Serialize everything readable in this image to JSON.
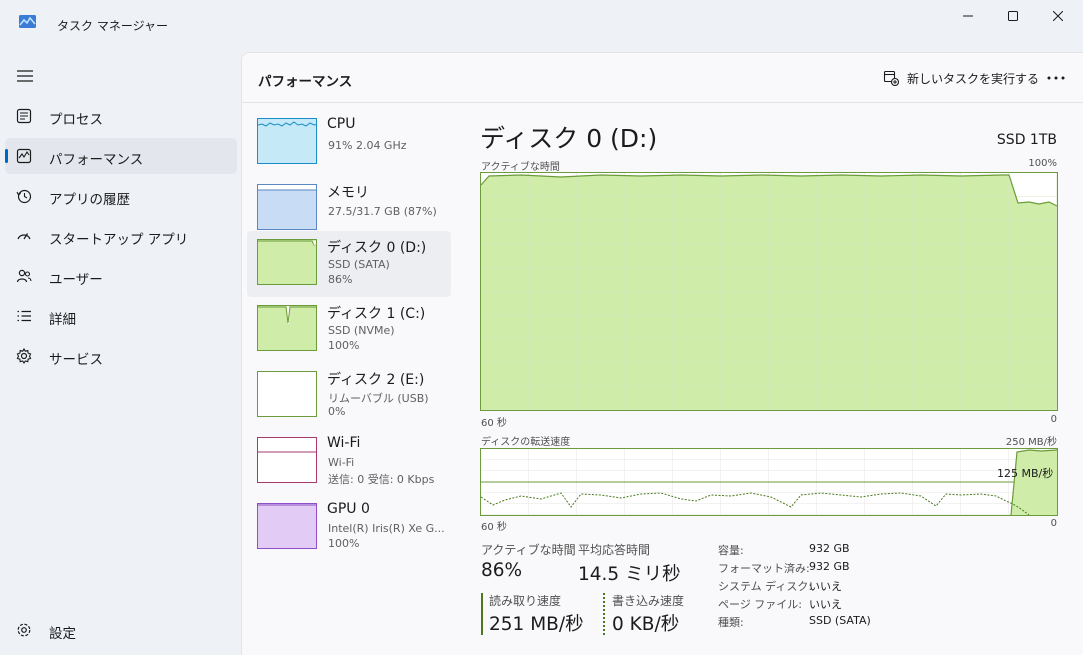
{
  "app": {
    "title": "タスク マネージャー"
  },
  "nav": {
    "items": [
      {
        "label": "プロセス",
        "icon": "processes-icon"
      },
      {
        "label": "パフォーマンス",
        "icon": "performance-icon",
        "active": true
      },
      {
        "label": "アプリの履歴",
        "icon": "app-history-icon"
      },
      {
        "label": "スタートアップ アプリ",
        "icon": "startup-icon"
      },
      {
        "label": "ユーザー",
        "icon": "users-icon"
      },
      {
        "label": "詳細",
        "icon": "details-icon"
      },
      {
        "label": "サービス",
        "icon": "services-icon"
      }
    ],
    "settings_label": "設定"
  },
  "header": {
    "title": "パフォーマンス",
    "run_task_label": "新しいタスクを実行する"
  },
  "devices": [
    {
      "name": "CPU",
      "line1": "91%  2.04 GHz",
      "line2": "",
      "color": "#1a8ec9",
      "fill": "#c6e9f7"
    },
    {
      "name": "メモリ",
      "line1": "27.5/31.7 GB (87%)",
      "line2": "",
      "color": "#5b87c4",
      "fill": "#c9dcf5"
    },
    {
      "name": "ディスク 0 (D:)",
      "line1": "SSD (SATA)",
      "line2": "86%",
      "color": "#6b9b3a",
      "fill": "#cfeca8",
      "selected": true
    },
    {
      "name": "ディスク 1 (C:)",
      "line1": "SSD (NVMe)",
      "line2": "100%",
      "color": "#6b9b3a",
      "fill": "#cfeca8"
    },
    {
      "name": "ディスク 2 (E:)",
      "line1": "リムーバブル (USB)",
      "line2": "0%",
      "color": "#6b9b3a",
      "fill": "#ffffff"
    },
    {
      "name": "Wi-Fi",
      "line1": "Wi-Fi",
      "line2": "送信: 0 受信: 0 Kbps",
      "color": "#a6396a",
      "fill": "#ffffff"
    },
    {
      "name": "GPU 0",
      "line1": "Intel(R) Iris(R) Xe G...",
      "line2": "100%",
      "color": "#8e4fc8",
      "fill": "#e2ccf5"
    }
  ],
  "detail": {
    "title": "ディスク 0 (D:)",
    "model": "SSD 1TB",
    "active_graph": {
      "label": "アクティブな時間",
      "max_label": "100%",
      "time_label": "60 秒",
      "zero_label": "0"
    },
    "transfer_graph": {
      "label": "ディスクの転送速度",
      "max_label": "250 MB/秒",
      "mid_label": "125 MB/秒",
      "time_label": "60 秒",
      "zero_label": "0"
    },
    "stats": {
      "active_time_label": "アクティブな時間",
      "active_time_value": "86%",
      "response_label": "平均応答時間",
      "response_value": "14.5 ミリ秒",
      "read_label": "読み取り速度",
      "read_value": "251 MB/秒",
      "write_label": "書き込み速度",
      "write_value": "0 KB/秒"
    },
    "properties": [
      {
        "key": "容量:",
        "value": "932 GB"
      },
      {
        "key": "フォーマット済み:",
        "value": "932 GB"
      },
      {
        "key": "システム ディスク:",
        "value": "いいえ"
      },
      {
        "key": "ページ ファイル:",
        "value": "いいえ"
      },
      {
        "key": "種類:",
        "value": "SSD (SATA)"
      }
    ]
  },
  "colors": {
    "accent": "#0067c0",
    "disk_line": "#6b9b3a",
    "disk_fill": "#cfeca8"
  }
}
